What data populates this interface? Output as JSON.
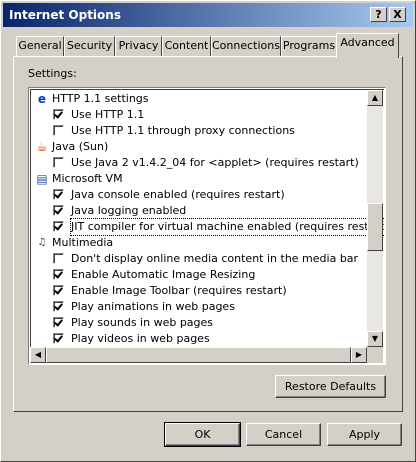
{
  "window": {
    "title": "Internet Options",
    "help_label": "?",
    "close_label": "X"
  },
  "tabs": [
    {
      "label": "General"
    },
    {
      "label": "Security"
    },
    {
      "label": "Privacy"
    },
    {
      "label": "Content"
    },
    {
      "label": "Connections"
    },
    {
      "label": "Programs"
    },
    {
      "label": "Advanced",
      "active": true
    }
  ],
  "settings": {
    "label": "Settings:",
    "items": [
      {
        "type": "category",
        "icon": "ie-icon",
        "label": "HTTP 1.1 settings"
      },
      {
        "type": "checkbox",
        "checked": true,
        "label": "Use HTTP 1.1"
      },
      {
        "type": "checkbox",
        "checked": false,
        "label": "Use HTTP 1.1 through proxy connections"
      },
      {
        "type": "category",
        "icon": "java-icon",
        "label": "Java (Sun)"
      },
      {
        "type": "checkbox",
        "checked": false,
        "label": "Use Java 2 v1.4.2_04 for <applet> (requires restart)"
      },
      {
        "type": "category",
        "icon": "document-icon",
        "label": "Microsoft VM"
      },
      {
        "type": "checkbox",
        "checked": true,
        "label": "Java console enabled (requires restart)"
      },
      {
        "type": "checkbox",
        "checked": true,
        "label": "Java logging enabled"
      },
      {
        "type": "checkbox",
        "checked": true,
        "label": "JIT compiler for virtual machine enabled (requires restart)",
        "focused": true
      },
      {
        "type": "category",
        "icon": "multimedia-icon",
        "label": "Multimedia"
      },
      {
        "type": "checkbox",
        "checked": false,
        "label": "Don't display online media content in the media bar"
      },
      {
        "type": "checkbox",
        "checked": true,
        "label": "Enable Automatic Image Resizing"
      },
      {
        "type": "checkbox",
        "checked": true,
        "label": "Enable Image Toolbar (requires restart)"
      },
      {
        "type": "checkbox",
        "checked": true,
        "label": "Play animations in web pages"
      },
      {
        "type": "checkbox",
        "checked": true,
        "label": "Play sounds in web pages"
      },
      {
        "type": "checkbox",
        "checked": true,
        "label": "Play videos in web pages"
      }
    ]
  },
  "buttons": {
    "restore_defaults": "Restore Defaults",
    "ok": "OK",
    "cancel": "Cancel",
    "apply": "Apply"
  }
}
